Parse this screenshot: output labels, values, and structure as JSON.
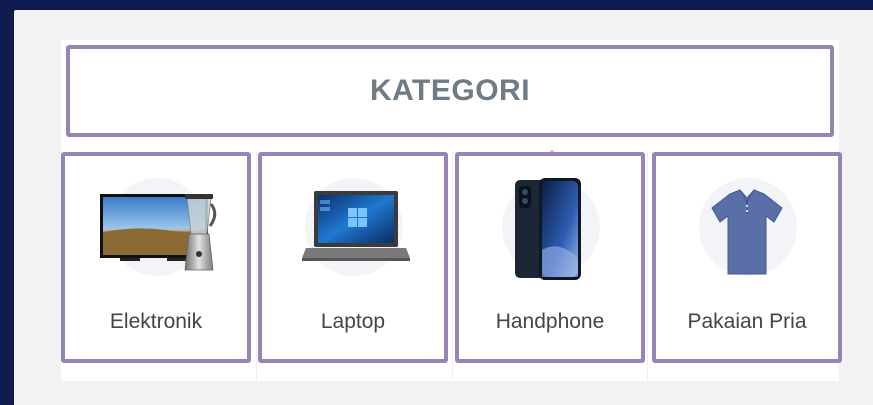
{
  "kategori": {
    "title": "KATEGORI",
    "items": [
      {
        "label": "Elektronik",
        "icon": "tv-blender-icon"
      },
      {
        "label": "Laptop",
        "icon": "laptop-icon"
      },
      {
        "label": "Handphone",
        "icon": "smartphone-icon"
      },
      {
        "label": "Pakaian Pria",
        "icon": "polo-shirt-icon"
      }
    ]
  },
  "colors": {
    "page_background": "#0f1a4f",
    "card_border": "#9784b7",
    "title_text": "#6f7b85",
    "label_text": "#444444"
  }
}
